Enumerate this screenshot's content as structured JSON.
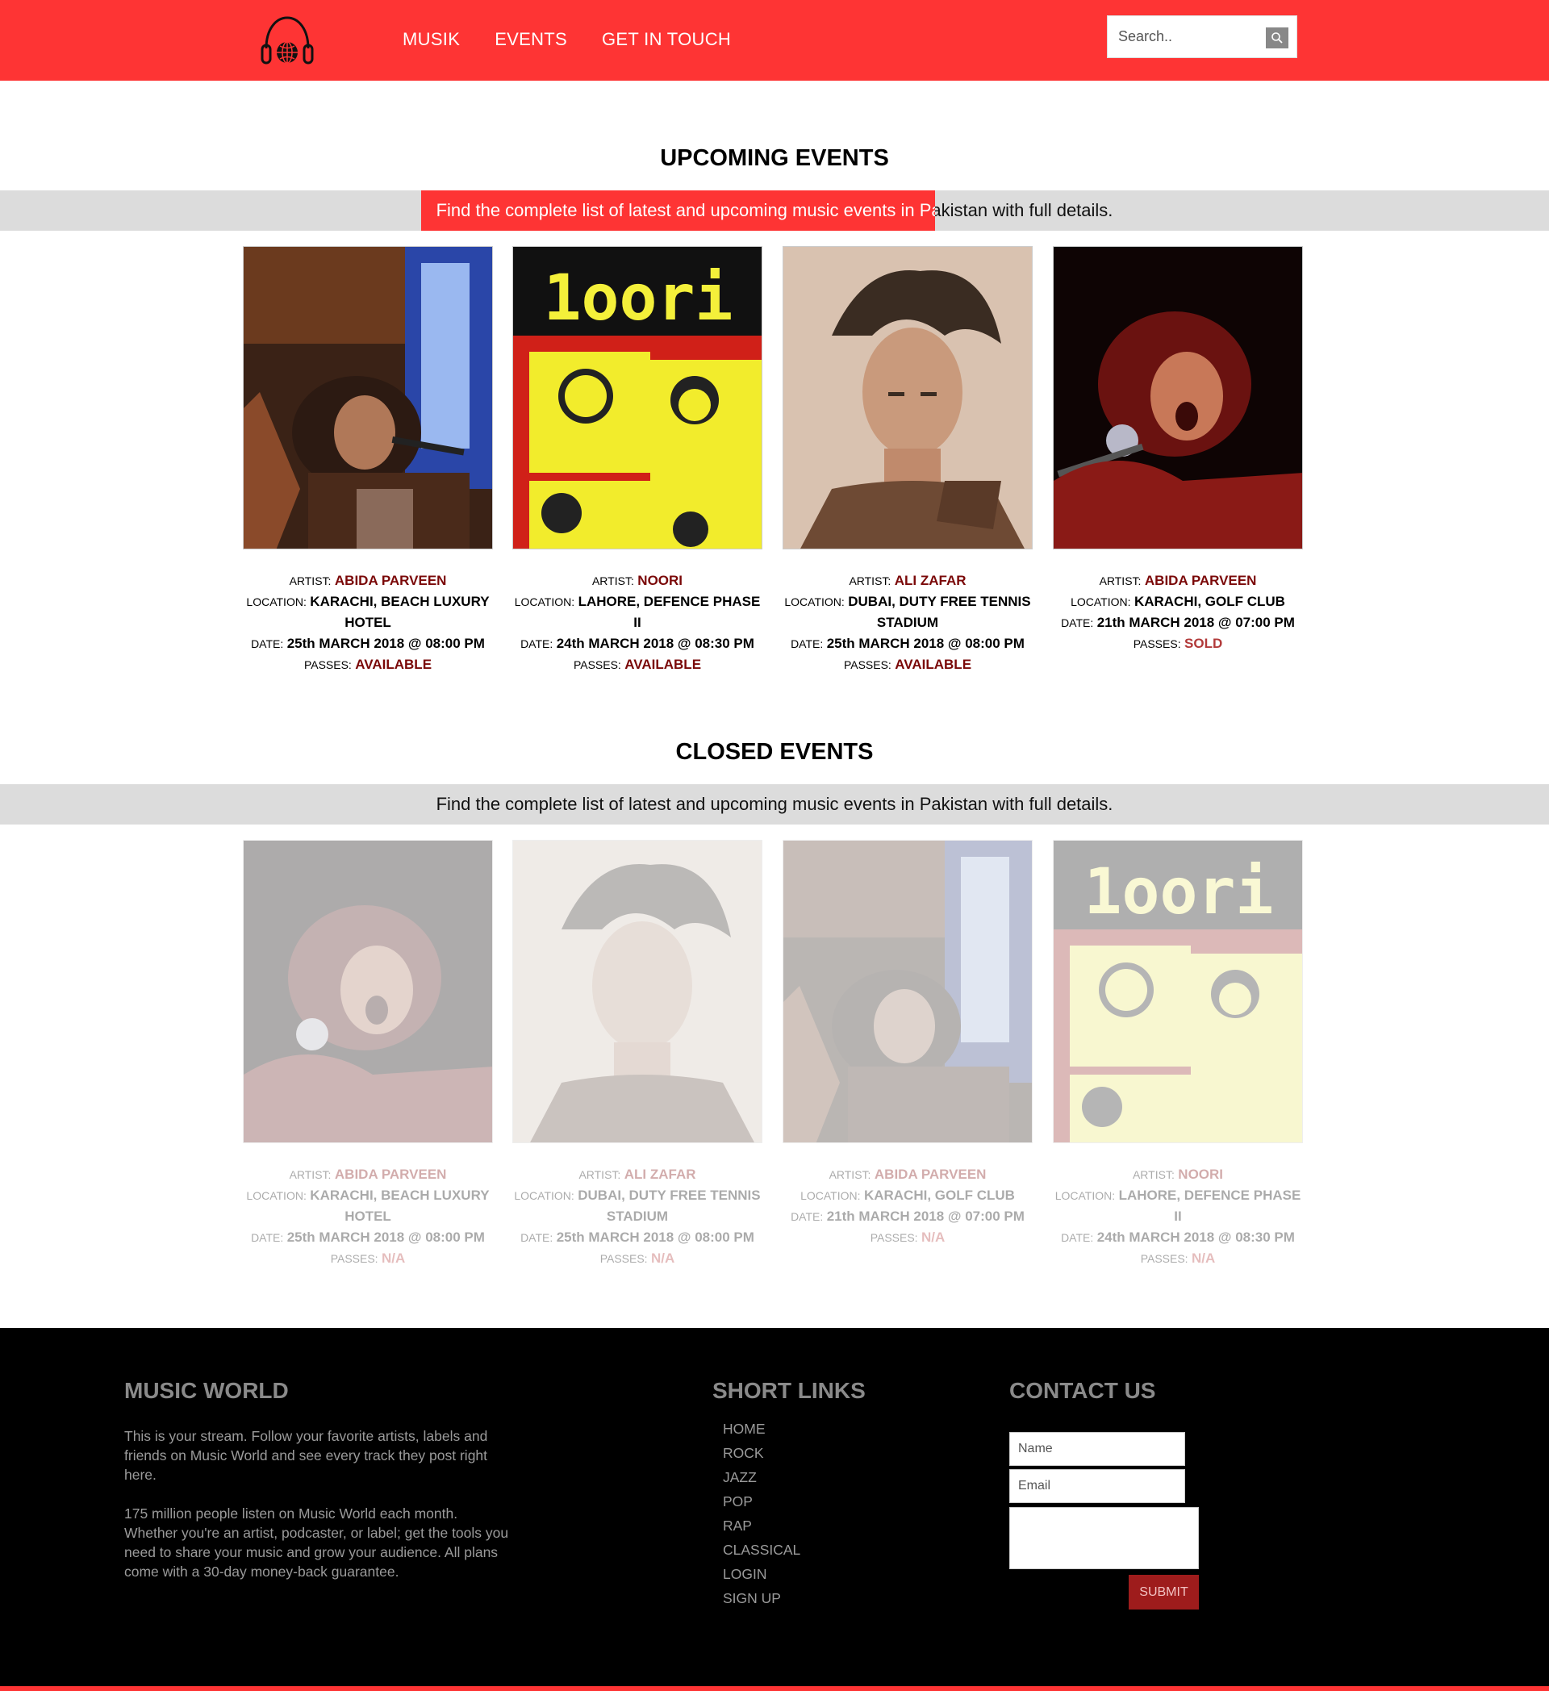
{
  "header": {
    "nav": [
      "MUSIK",
      "EVENTS",
      "GET IN TOUCH"
    ],
    "search_placeholder": "Search..",
    "logo_icon": "headphones-globe-icon",
    "search_icon": "search-icon"
  },
  "upcoming": {
    "title": "UPCOMING EVENTS",
    "subtitle": "Find the complete list of latest and upcoming music events in Pakistan with full details.",
    "events": [
      {
        "artist": "ABIDA PARVEEN",
        "location": "KARACHI, BEACH LUXURY HOTEL",
        "date": "25th MARCH 2018 @ 08:00 PM",
        "passes": "AVAILABLE"
      },
      {
        "artist": "NOORI",
        "location": "LAHORE, DEFENCE PHASE II",
        "date": "24th MARCH 2018 @ 08:30 PM",
        "passes": "AVAILABLE"
      },
      {
        "artist": "ALI ZAFAR",
        "location": "DUBAI, DUTY FREE TENNIS STADIUM",
        "date": "25th MARCH 2018 @ 08:00 PM",
        "passes": "AVAILABLE"
      },
      {
        "artist": "ABIDA PARVEEN",
        "location": "KARACHI, GOLF CLUB",
        "date": "21th MARCH 2018 @ 07:00 PM",
        "passes": "SOLD"
      }
    ]
  },
  "closed": {
    "title": "CLOSED EVENTS",
    "subtitle": "Find the complete list of latest and upcoming music events in Pakistan with full details.",
    "events": [
      {
        "artist": "ABIDA PARVEEN",
        "location": "KARACHI, BEACH LUXURY HOTEL",
        "date": "25th MARCH 2018 @ 08:00 PM",
        "passes": "N/A"
      },
      {
        "artist": "ALI ZAFAR",
        "location": "DUBAI, DUTY FREE TENNIS STADIUM",
        "date": "25th MARCH 2018 @ 08:00 PM",
        "passes": "N/A"
      },
      {
        "artist": "ABIDA PARVEEN",
        "location": "KARACHI, GOLF CLUB",
        "date": "21th MARCH 2018 @ 07:00 PM",
        "passes": "N/A"
      },
      {
        "artist": "NOORI",
        "location": "LAHORE, DEFENCE PHASE II",
        "date": "24th MARCH 2018 @ 08:30 PM",
        "passes": "N/A"
      }
    ]
  },
  "labels": {
    "artist": "ARTIST:",
    "location": "LOCATION:",
    "date": "DATE:",
    "passes": "PASSES:"
  },
  "footer": {
    "about_title": "MUSIC WORLD",
    "about_p1": "This is your stream. Follow your favorite artists, labels and friends on Music World and see every track they post right here.",
    "about_p2": "175 million people listen on Music World each month. Whether you're an artist, podcaster, or label; get the tools you need to share your music and grow your audience. All plans come with a 30-day money-back guarantee.",
    "links_title": "SHORT LINKS",
    "links": [
      "HOME",
      "ROCK",
      "JAZZ",
      "POP",
      "RAP",
      "CLASSICAL",
      "LOGIN",
      "SIGN UP"
    ],
    "contact_title": "CONTACT US",
    "name_placeholder": "Name",
    "email_placeholder": "Email",
    "submit": "SUBMIT"
  },
  "colors": {
    "brand_red": "#fe3434",
    "dark_red": "#7a0808",
    "band_grey": "#dcdcdc",
    "footer_black": "#000000"
  }
}
